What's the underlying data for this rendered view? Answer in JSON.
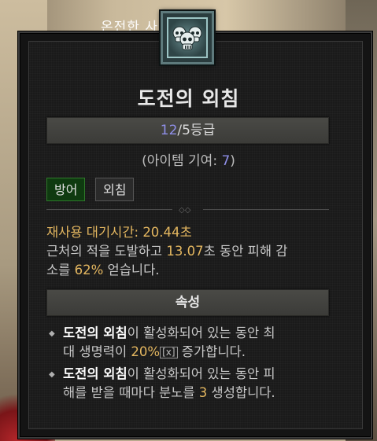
{
  "background": {
    "label": "온전한 사"
  },
  "skill": {
    "icon": "skull-cluster-icon",
    "name": "도전의 외침",
    "rank_current": "12",
    "rank_rest": "/5등급",
    "item_contrib_prefix": "(아이템 기여: ",
    "item_contrib_value": "7",
    "item_contrib_suffix": ")",
    "tags": [
      "방어",
      "외침"
    ],
    "cooldown_label": "재사용 대기시간: ",
    "cooldown_value": "20.44",
    "cooldown_unit": "초",
    "desc_a": "근처의 적을 도발하고 ",
    "desc_duration": "13.07",
    "desc_b": "초 동안 피해 감",
    "desc_c": "소를 ",
    "desc_pct": "62%",
    "desc_d": " 얻습니다."
  },
  "properties": {
    "title": "속성",
    "p1": {
      "skill": "도전의 외침",
      "a": "이 활성화되어 있는 동안 최",
      "b": "대 생명력이 ",
      "value": "20%",
      "x": "[x]",
      "c": " 증가합니다."
    },
    "p2": {
      "skill": "도전의 외침",
      "a": "이 활성화되어 있는 동안 피",
      "b": "해를 받을 때마다 분노를 ",
      "value": "3",
      "c": " 생성합니다."
    }
  },
  "colors": {
    "rank": "#8f8fe8",
    "highlight": "#e4b760",
    "tag_defense_bg": "#0f3a10"
  }
}
